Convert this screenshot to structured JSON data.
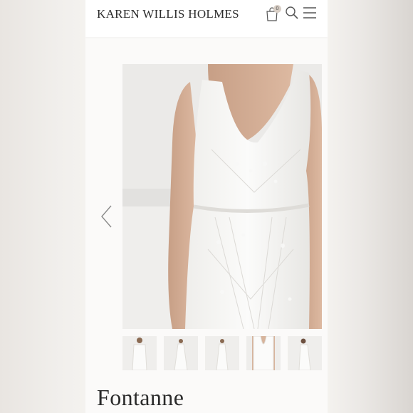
{
  "header": {
    "brand": "KAREN WILLIS HOLMES",
    "cart_count": "0",
    "icons": [
      "cart-icon",
      "search-icon",
      "menu-icon"
    ]
  },
  "gallery": {
    "nav_icon": "chevron-left-icon",
    "main_image_icon": "wedding-dress-photo",
    "thumbnails": [
      "dress-front-closeup",
      "dress-full-length",
      "dress-full-length-alt",
      "dress-bodice-closeup",
      "dress-side-view"
    ]
  },
  "product": {
    "name": "Fontanne"
  },
  "colors": {
    "page_bg": "#fbfaf9",
    "text": "#2a2a2a",
    "badge": "#d9cfc6"
  }
}
